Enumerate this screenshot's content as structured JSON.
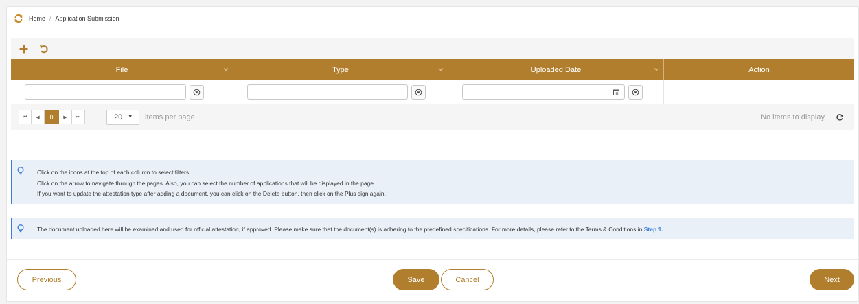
{
  "breadcrumb": {
    "home": "Home",
    "separator": "/",
    "current": "Application Submission"
  },
  "toolbar": {
    "add_icon": "plus-icon",
    "reset_icon": "undo-icon"
  },
  "grid": {
    "columns": [
      {
        "label": "File",
        "filterable": true
      },
      {
        "label": "Type",
        "filterable": true
      },
      {
        "label": "Uploaded Date",
        "filterable": true
      },
      {
        "label": "Action",
        "filterable": false
      }
    ],
    "filters": {
      "file": "",
      "type": "",
      "uploaded_date": ""
    }
  },
  "pager": {
    "current_page": "0",
    "page_size": "20",
    "items_per_page_label": "items per page",
    "empty_message": "No items to display"
  },
  "info_box_1": {
    "line1": "Click on the icons at the top of each column to select filters.",
    "line2": "Click on the arrow to navigate through the pages. Also, you can select the number of applications that will be displayed in the page.",
    "line3": "If you want to update the attestation type after adding a document, you can click on the Delete button, then click on the Plus sign again."
  },
  "info_box_2": {
    "text": "The document uploaded here will be examined and used for official attestation, if approved. Please make sure that the document(s) is adhering to the predefined specifications. For more details, please refer to the Terms & Conditions in ",
    "link": "Step 1."
  },
  "footer": {
    "previous": "Previous",
    "save": "Save",
    "cancel": "Cancel",
    "next": "Next"
  },
  "colors": {
    "accent": "#b07e2d",
    "info_border": "#3f7ed8",
    "info_bg": "#e9f0f8"
  }
}
